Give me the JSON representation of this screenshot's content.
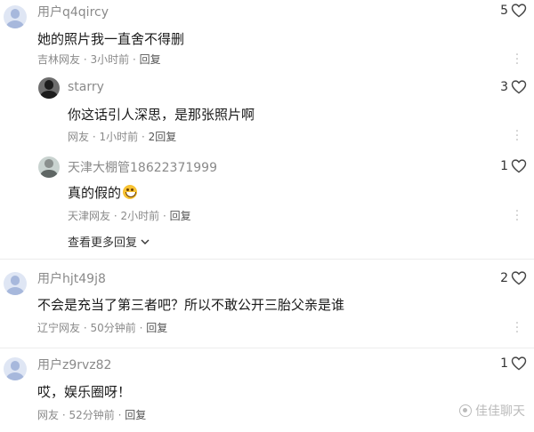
{
  "comments": [
    {
      "username": "用户q4qircy",
      "text": "她的照片我一直舍不得删",
      "location": "吉林网友",
      "time": "3小时前",
      "reply": "回复",
      "likes": "5",
      "replies": [
        {
          "username": "starry",
          "text": "你这话引人深思，是那张照片啊",
          "location": "网友",
          "time": "1小时前",
          "reply": "2回复",
          "likes": "3"
        },
        {
          "username": "天津大棚管18622371999",
          "text": "真的假的",
          "location": "天津网友",
          "time": "2小时前",
          "reply": "回复",
          "likes": "1"
        }
      ],
      "view_more": "查看更多回复"
    },
    {
      "username": "用户hjt49j8",
      "text": "不会是充当了第三者吧？所以不敢公开三胎父亲是谁",
      "location": "辽宁网友",
      "time": "50分钟前",
      "reply": "回复",
      "likes": "2"
    },
    {
      "username": "用户z9rvz82",
      "text": "哎，娱乐圈呀！",
      "location": "网友",
      "time": "52分钟前",
      "reply": "回复",
      "likes": "1"
    }
  ],
  "separator": "·",
  "watermark": "佳佳聊天",
  "icons": {
    "like": "heart-outline-icon",
    "more": "vertical-dots-icon",
    "avatar_default": "default-user-avatar",
    "emoji": "grinning-face-emoji"
  }
}
